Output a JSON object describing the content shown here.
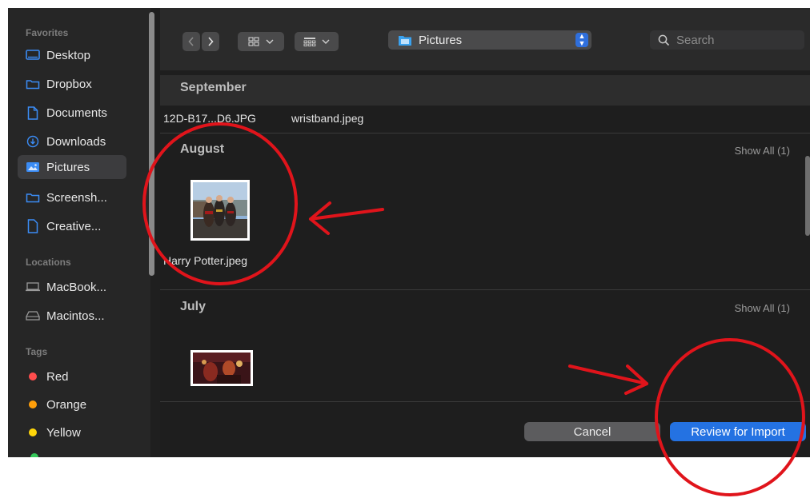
{
  "sidebar": {
    "favorites_heading": "Favorites",
    "favorites": [
      {
        "label": "Desktop",
        "icon": "desktop-icon"
      },
      {
        "label": "Dropbox",
        "icon": "folder-icon"
      },
      {
        "label": "Documents",
        "icon": "document-icon"
      },
      {
        "label": "Downloads",
        "icon": "download-icon"
      },
      {
        "label": "Pictures",
        "icon": "pictures-icon",
        "selected": true
      },
      {
        "label": "Screensh...",
        "icon": "folder-icon"
      },
      {
        "label": "Creative...",
        "icon": "document-icon"
      }
    ],
    "locations_heading": "Locations",
    "locations": [
      {
        "label": "MacBook...",
        "icon": "laptop-icon"
      },
      {
        "label": "Macintos...",
        "icon": "drive-icon"
      }
    ],
    "tags_heading": "Tags",
    "tags": [
      {
        "label": "Red",
        "color": "#ff4d4d"
      },
      {
        "label": "Orange",
        "color": "#ff9f0a"
      },
      {
        "label": "Yellow",
        "color": "#ffd60a"
      }
    ]
  },
  "toolbar": {
    "location": "Pictures",
    "search_placeholder": "Search"
  },
  "sections": {
    "september": {
      "title": "September",
      "files": [
        "12D-B17...D6.JPG",
        "wristband.jpeg"
      ]
    },
    "august": {
      "title": "August",
      "show_all": "Show All (1)",
      "files": [
        "Harry Potter.jpeg"
      ]
    },
    "july": {
      "title": "July",
      "show_all": "Show All (1)"
    }
  },
  "buttons": {
    "cancel": "Cancel",
    "review": "Review for Import"
  },
  "colors": {
    "accent": "#2472e2",
    "annotation": "#e0141b"
  }
}
